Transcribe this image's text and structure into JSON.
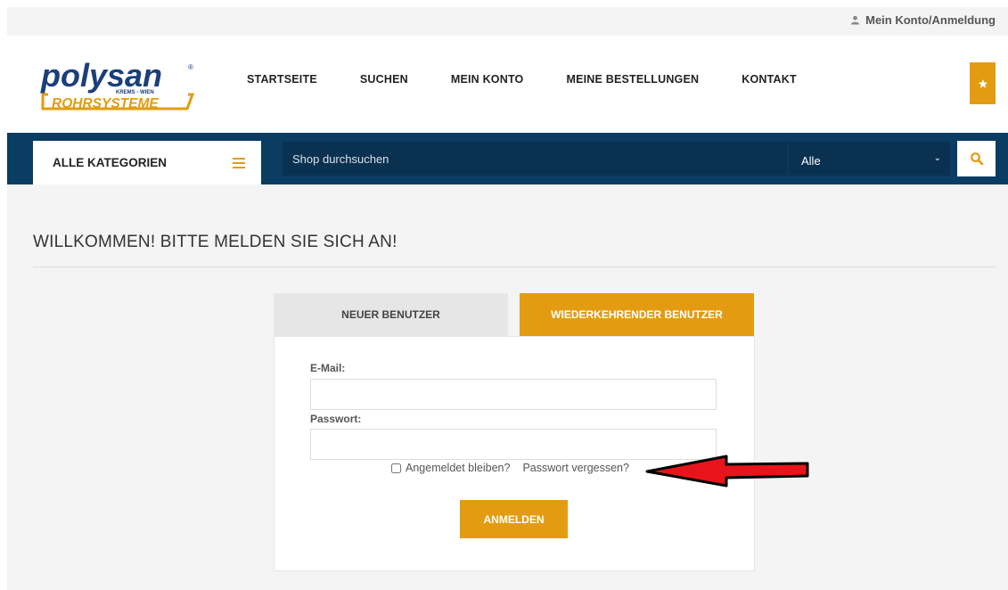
{
  "topbar": {
    "account_label": "Mein Konto/Anmeldung"
  },
  "header": {
    "logo": {
      "main": "polysan",
      "sub": "KREMS - WIEN",
      "tagline": "ROHRSYSTEME"
    },
    "nav": [
      "STARTSEITE",
      "SUCHEN",
      "MEIN KONTO",
      "MEINE BESTELLUNGEN",
      "KONTAKT"
    ]
  },
  "search": {
    "categories_label": "ALLE KATEGORIEN",
    "placeholder": "Shop durchsuchen",
    "scope_selected": "Alle"
  },
  "main": {
    "title": "WILLKOMMEN! BITTE MELDEN SIE SICH AN!",
    "tabs": {
      "new_user": "NEUER BENUTZER",
      "returning_user": "WIEDERKEHRENDER BENUTZER"
    },
    "form": {
      "email_label": "E-Mail:",
      "email_value": "",
      "password_label": "Passwort:",
      "password_value": "",
      "remember_label": "Angemeldet bleiben?",
      "forgot_label": "Passwort vergessen?",
      "submit_label": "ANMELDEN"
    }
  },
  "colors": {
    "accent": "#e39c11",
    "navy": "#0b3c61",
    "arrow": "#e8141b"
  }
}
